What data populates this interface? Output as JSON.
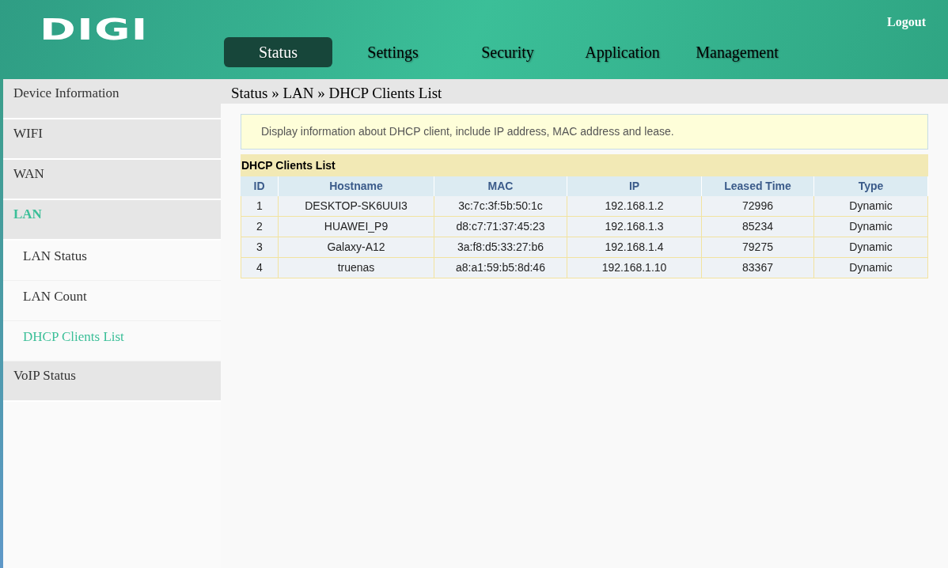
{
  "header": {
    "logo": "DIGI",
    "logout": "Logout"
  },
  "nav_tabs": [
    {
      "label": "Status",
      "selected": true
    },
    {
      "label": "Settings",
      "selected": false
    },
    {
      "label": "Security",
      "selected": false
    },
    {
      "label": "Application",
      "selected": false
    },
    {
      "label": "Management",
      "selected": false
    }
  ],
  "sidebar": {
    "items": [
      {
        "label": "Device Information",
        "selected": false
      },
      {
        "label": "WIFI",
        "selected": false
      },
      {
        "label": "WAN",
        "selected": false
      },
      {
        "label": "LAN",
        "selected": true,
        "expanded": true,
        "children": [
          {
            "label": "LAN Status",
            "selected": false
          },
          {
            "label": "LAN Count",
            "selected": false
          },
          {
            "label": "DHCP Clients List",
            "selected": true
          }
        ]
      },
      {
        "label": "VoIP Status",
        "selected": false
      }
    ]
  },
  "breadcrumb": "Status » LAN » DHCP Clients List",
  "info": "Display information about DHCP client, include IP address, MAC address and lease.",
  "table": {
    "title": "DHCP Clients List",
    "columns": [
      "ID",
      "Hostname",
      "MAC",
      "IP",
      "Leased Time",
      "Type"
    ],
    "rows": [
      [
        "1",
        "DESKTOP-SK6UUI3",
        "3c:7c:3f:5b:50:1c",
        "192.168.1.2",
        "72996",
        "Dynamic"
      ],
      [
        "2",
        "HUAWEI_P9",
        "d8:c7:71:37:45:23",
        "192.168.1.3",
        "85234",
        "Dynamic"
      ],
      [
        "3",
        "Galaxy-A12",
        "3a:f8:d5:33:27:b6",
        "192.168.1.4",
        "79275",
        "Dynamic"
      ],
      [
        "4",
        "truenas",
        "a8:a1:59:b5:8d:46",
        "192.168.1.10",
        "83367",
        "Dynamic"
      ]
    ]
  }
}
